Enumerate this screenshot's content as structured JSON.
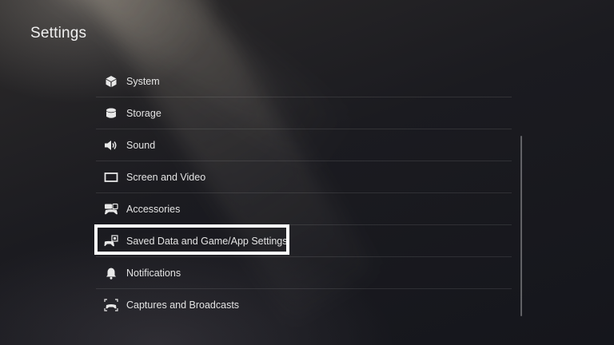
{
  "header": {
    "title": "Settings"
  },
  "menu": {
    "items": [
      {
        "label": "System",
        "icon": "system-cube-icon"
      },
      {
        "label": "Storage",
        "icon": "storage-icon"
      },
      {
        "label": "Sound",
        "icon": "speaker-icon"
      },
      {
        "label": "Screen and Video",
        "icon": "screen-icon"
      },
      {
        "label": "Accessories",
        "icon": "accessories-icon"
      },
      {
        "label": "Saved Data and Game/App Settings",
        "icon": "saved-data-icon"
      },
      {
        "label": "Notifications",
        "icon": "bell-icon"
      },
      {
        "label": "Captures and Broadcasts",
        "icon": "captures-icon"
      }
    ],
    "focused_index": 5
  },
  "colors": {
    "background": "#1b1b20",
    "text": "#e4e4e4",
    "focus_border": "#ffffff"
  }
}
